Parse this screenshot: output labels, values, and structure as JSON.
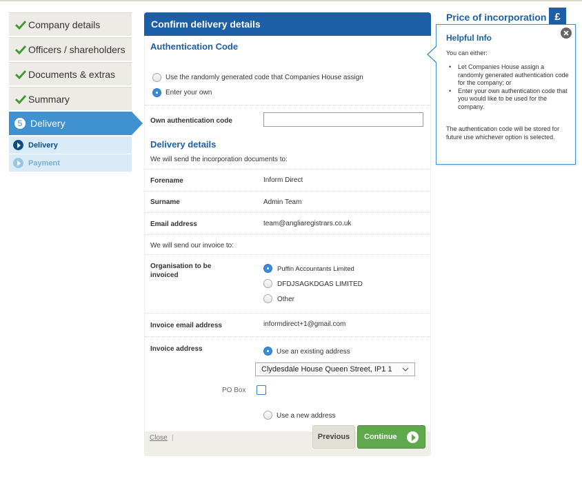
{
  "sidebar": {
    "steps": [
      {
        "label": "Company details",
        "state": "done"
      },
      {
        "label": "Officers / shareholders",
        "state": "done"
      },
      {
        "label": "Documents & extras",
        "state": "done"
      },
      {
        "label": "Summary",
        "state": "done"
      }
    ],
    "active": {
      "number": "5",
      "label": "Delivery"
    },
    "substeps": [
      {
        "label": "Delivery",
        "state": "current"
      },
      {
        "label": "Payment",
        "state": "upcoming"
      }
    ]
  },
  "panel": {
    "title": "Confirm delivery details",
    "auth": {
      "title": "Authentication Code",
      "options": [
        {
          "label": "Use the randomly generated code that Companies House assign",
          "selected": false
        },
        {
          "label": "Enter your own",
          "selected": true
        }
      ],
      "own_code_label": "Own authentication code",
      "own_code_value": ""
    },
    "delivery": {
      "title": "Delivery details",
      "intro": "We will send the incorporation documents to:",
      "forename_label": "Forename",
      "forename": "Inform Direct",
      "surname_label": "Surname",
      "surname": "Admin Team",
      "email_label": "Email address",
      "email": "team@angliaregistrars.co.uk",
      "invoice_intro": "We will send our invoice to:",
      "org_label_1": "Organisation to be",
      "org_label_2": "invoiced",
      "org_options": [
        {
          "label": "Puffin Accountants Limited",
          "selected": true
        },
        {
          "label": "DFDJSAGKDGAS LIMITED",
          "selected": false
        },
        {
          "label": "Other",
          "selected": false
        }
      ],
      "invoice_email_label": "Invoice email address",
      "invoice_email": "informdirect+1@gmail.com",
      "invoice_address_label": "Invoice address",
      "use_existing_label": "Use an existing address",
      "existing_address": "Clydesdale House Queen Street, IP1 1",
      "po_box_label": "PO Box",
      "use_new_label": "Use a new address"
    },
    "footer": {
      "close": "Close",
      "previous": "Previous",
      "continue": "Continue"
    }
  },
  "price": {
    "title": "Price of incorporation",
    "symbol": "£"
  },
  "help": {
    "title": "Helpful Info",
    "intro": "You can either:",
    "items": [
      "Let Companies House assign a randomly generated authentication code for the company; or",
      "Enter your own authentication code that you would like to be used for the company."
    ],
    "note": "The authentication code will be stored for future use whichever option is selected."
  },
  "colors": {
    "brand_blue": "#1c5fa6",
    "active_step": "#3f91cf",
    "continue_green": "#5fa84b"
  }
}
